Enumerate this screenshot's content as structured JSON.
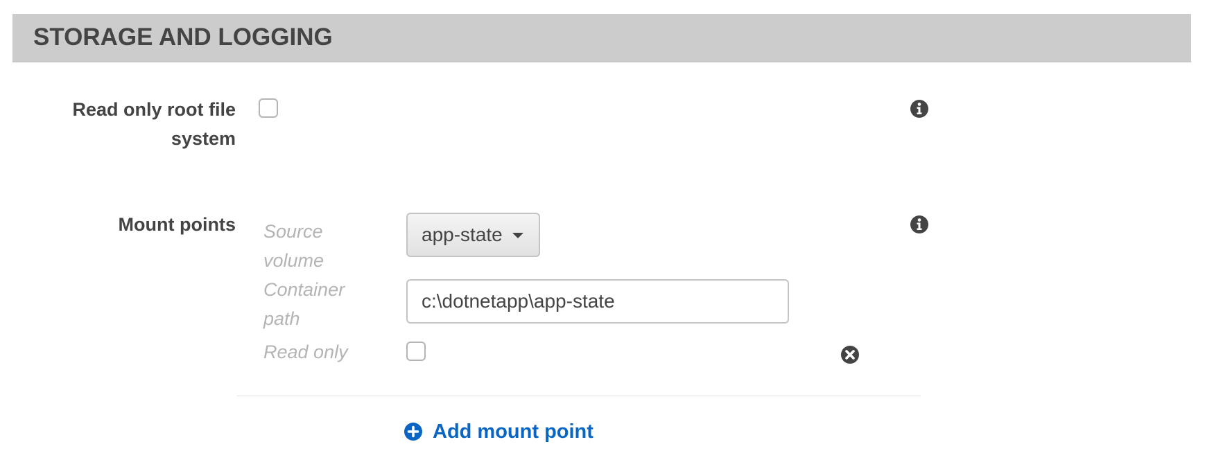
{
  "section": {
    "title": "STORAGE AND LOGGING"
  },
  "fields": {
    "read_only_root": {
      "label_line1": "Read only root file",
      "label_line2": "system",
      "checked": false
    },
    "mount_points": {
      "label": "Mount points",
      "source_volume_label_line1": "Source",
      "source_volume_label_line2": "volume",
      "source_volume_value": "app-state",
      "container_path_label_line1": "Container",
      "container_path_label_line2": "path",
      "container_path_value": "c:\\dotnetapp\\app-state",
      "read_only_label": "Read only",
      "read_only_checked": false,
      "add_label": "Add mount point"
    }
  },
  "icons": {
    "info": "info-icon",
    "remove": "close-circle-icon",
    "add": "plus-circle-icon",
    "dropdown": "caret-down-icon"
  },
  "colors": {
    "header_bg": "#cccccc",
    "link": "#0a66c2",
    "label": "#444444",
    "muted": "#b4b4b4"
  }
}
